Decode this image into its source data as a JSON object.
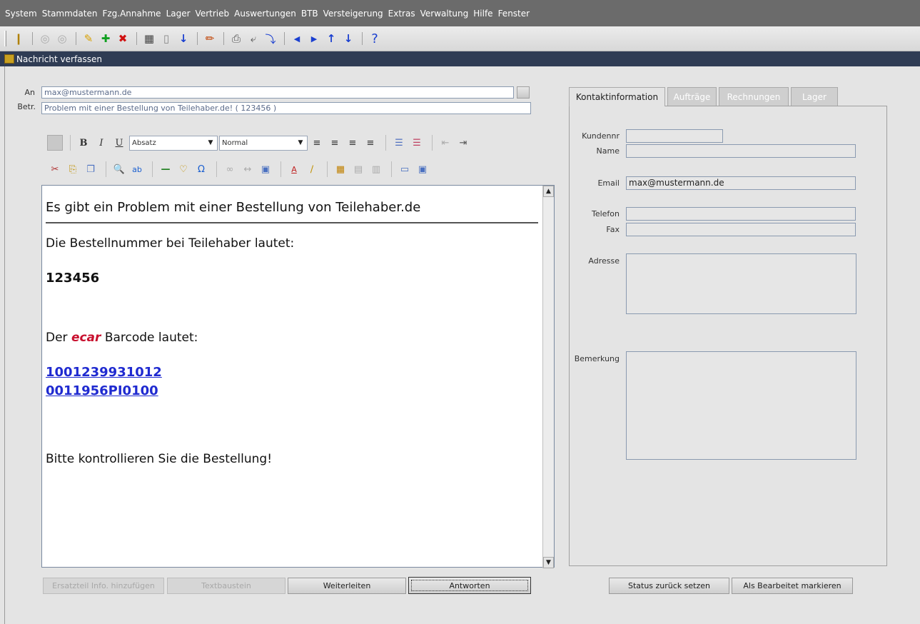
{
  "menu": {
    "items": [
      "System",
      "Stammdaten",
      "Fzg.Annahme",
      "Lager",
      "Vertrieb",
      "Auswertungen",
      "BTB",
      "Versteigerung",
      "Extras",
      "Verwaltung",
      "Hilfe",
      "Fenster"
    ]
  },
  "window": {
    "title": "Nachricht verfassen"
  },
  "compose": {
    "to_label": "An",
    "to_value": "max@mustermann.de",
    "subject_label": "Betr.",
    "subject_value": "Problem mit einer Bestellung von Teilehaber.de! ( 123456 )",
    "format_combo": "Absatz",
    "size_combo": "Normal"
  },
  "editor": {
    "line1": "Es gibt ein Problem mit einer Bestellung von Teilehaber.de",
    "line2": "Die Bestellnummer bei Teilehaber lautet:",
    "order_number": "123456",
    "barcode_prefix": "Der ",
    "brand": "ecar",
    "barcode_suffix": " Barcode lautet:",
    "barcode1": "1001239931012",
    "barcode2": "0011956PI0100",
    "closing": "Bitte kontrollieren Sie die Bestellung!"
  },
  "buttons": {
    "ersatzteil": "Ersatzteil Info. hinzufügen",
    "textbaustein": "Textbaustein",
    "weiterleiten": "Weiterleiten",
    "antworten": "Antworten",
    "status_reset": "Status zurück setzen",
    "mark_done": "Als Bearbeitet markieren"
  },
  "tabs": {
    "kontakt": "Kontaktinformation",
    "auftraege": "Aufträge",
    "rechnungen": "Rechnungen",
    "lager": "Lager"
  },
  "contact": {
    "kundennr_label": "Kundennr",
    "kundennr_value": "",
    "name_label": "Name",
    "name_value": "",
    "email_label": "Email",
    "email_value": "max@mustermann.de",
    "telefon_label": "Telefon",
    "telefon_value": "",
    "fax_label": "Fax",
    "fax_value": "",
    "adresse_label": "Adresse",
    "bemerkung_label": "Bemerkung"
  }
}
